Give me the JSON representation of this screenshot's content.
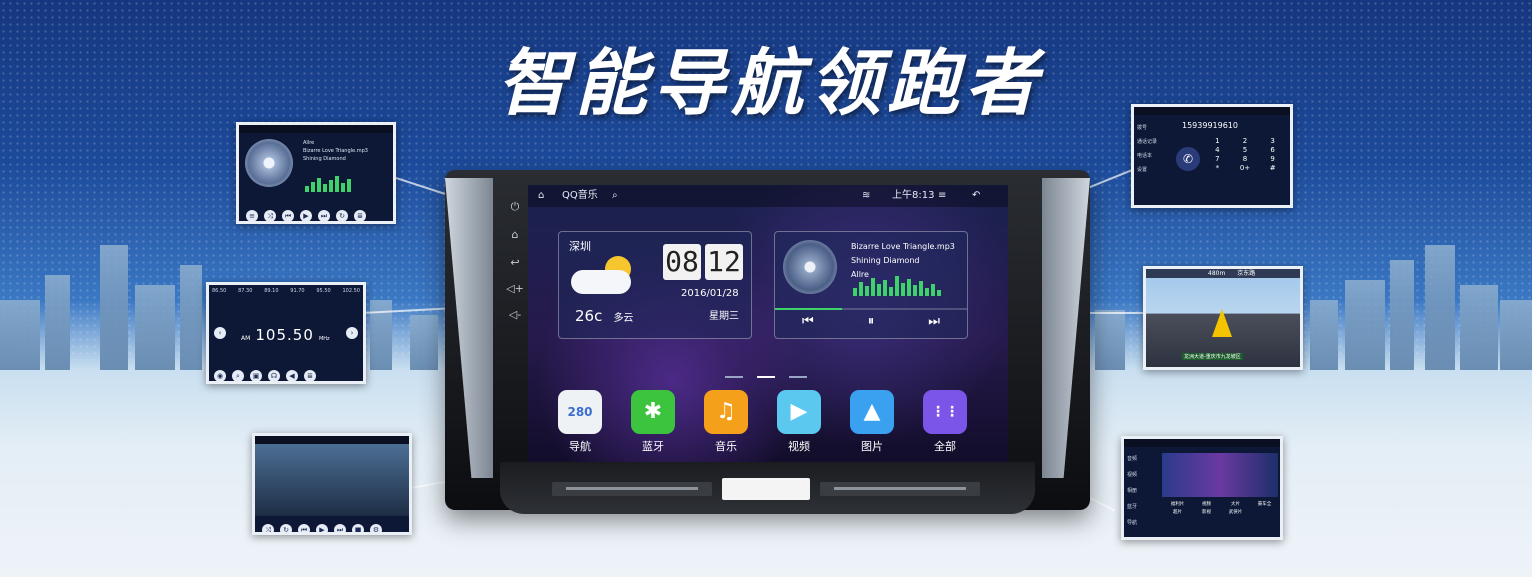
{
  "headline": "智能导航领跑者",
  "main_screen": {
    "status": {
      "app_name": "QQ音乐",
      "time": "上午8:13"
    },
    "weather": {
      "city": "深圳",
      "temp": "26c",
      "condition": "多云",
      "hour": "08",
      "minute": "12",
      "date": "2016/01/28",
      "weekday": "星期三"
    },
    "music": {
      "track": "Bizarre  Love Triangle.mp3",
      "album": "Shining Diamond",
      "artist": "Allre"
    },
    "apps": [
      {
        "label": "导航",
        "icon": "map-icon",
        "color": "#f3f3f3",
        "badge": "280"
      },
      {
        "label": "蓝牙",
        "icon": "bluetooth-icon",
        "color": "#3cc43e",
        "badge": "✱"
      },
      {
        "label": "音乐",
        "icon": "music-note-icon",
        "color": "#f5a01a",
        "badge": "♫"
      },
      {
        "label": "视频",
        "icon": "clapper-icon",
        "color": "#5bc8f0",
        "badge": "▶"
      },
      {
        "label": "图片",
        "icon": "gallery-icon",
        "color": "#3aa0f0",
        "badge": "▲"
      },
      {
        "label": "全部",
        "icon": "all-apps-icon",
        "color": "#7b55e8",
        "badge": "⋮⋮"
      }
    ]
  },
  "mini_music": {
    "artist": "Allre",
    "track": "Bizarre  Love Triangle.mp3",
    "album": "Shining Diamond"
  },
  "mini_radio": {
    "presets": [
      "86.50",
      "87.30",
      "89.10",
      "91.70",
      "95.50",
      "102.50"
    ],
    "band": "AM",
    "freq": "105.50",
    "unit": "MHz"
  },
  "mini_phone": {
    "number": "15939919610",
    "menu": [
      "拨号",
      "通话记录",
      "电话本",
      "设置"
    ],
    "keys": [
      "1",
      "2",
      "3",
      "4",
      "5",
      "6",
      "7",
      "8",
      "9",
      "*",
      "0+",
      "#"
    ]
  },
  "mini_nav": {
    "distance": "480m",
    "road": "京东路",
    "location": "龙洲大道-重庆市九龙坡区"
  },
  "mini_video": {
    "menu": [
      "音频",
      "视频",
      "相册",
      "蓝牙",
      "导航"
    ],
    "tags": [
      "福利片",
      "视频",
      "大片",
      "豪车全",
      "超片",
      "影视",
      "武侠片"
    ]
  }
}
